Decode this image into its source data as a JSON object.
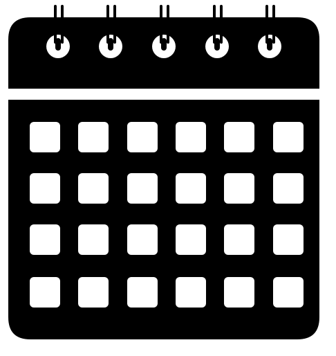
{
  "icon": {
    "name": "calendar-icon",
    "foreground_color": "#000000",
    "background_color": "#ffffff",
    "ring_count": 5,
    "grid": {
      "rows": 4,
      "columns": 6
    }
  }
}
